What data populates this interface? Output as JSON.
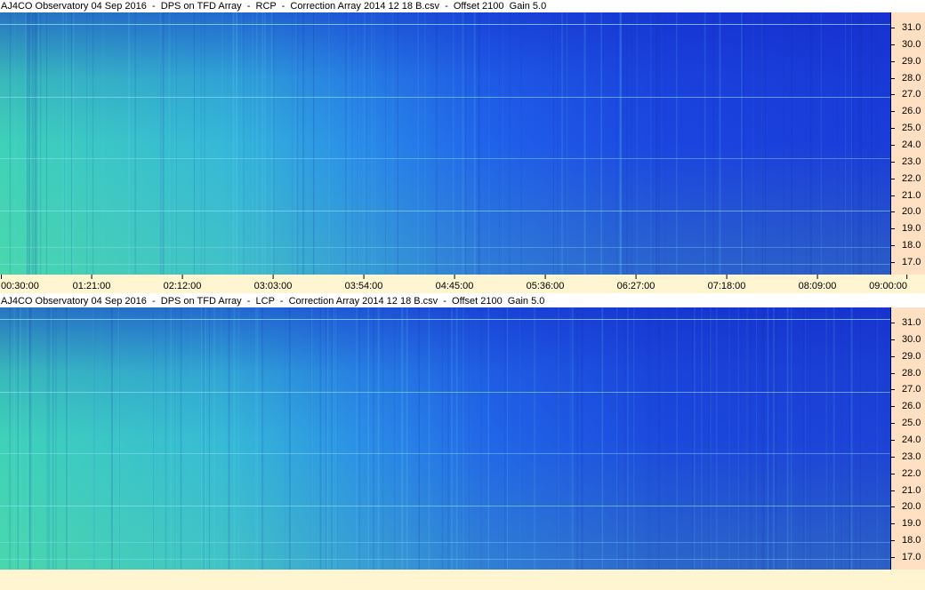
{
  "panels": [
    {
      "title": "AJ4CO Observatory 04 Sep 2016  -  DPS on TFD Array  -  RCP  -  Correction Array 2014 12 18 B.csv  -  Offset 2100  Gain 5.0",
      "polarization": "RCP"
    },
    {
      "title": "AJ4CO Observatory 04 Sep 2016  -  DPS on TFD Array  -  LCP  -  Correction Array 2014 12 18 B.csv  -  Offset 2100  Gain 5.0",
      "polarization": "LCP"
    }
  ],
  "y_axis": {
    "labels": [
      "31.0",
      "30.0",
      "29.0",
      "28.0",
      "27.0",
      "26.0",
      "25.0",
      "24.0",
      "23.0",
      "22.0",
      "21.0",
      "20.0",
      "19.0",
      "18.0",
      "17.0"
    ]
  },
  "x_axis": {
    "labels": [
      "00:30:00",
      "01:21:00",
      "02:12:00",
      "03:03:00",
      "03:54:00",
      "04:45:00",
      "05:36:00",
      "06:27:00",
      "07:18:00",
      "08:09:00",
      "09:00:00"
    ]
  },
  "colors": {
    "axis_background": "#ffe0c2",
    "time_strip_background": "#fff5d0",
    "spectrogram_low": "#1a3fe0",
    "spectrogram_high": "#4fe0a8"
  }
}
